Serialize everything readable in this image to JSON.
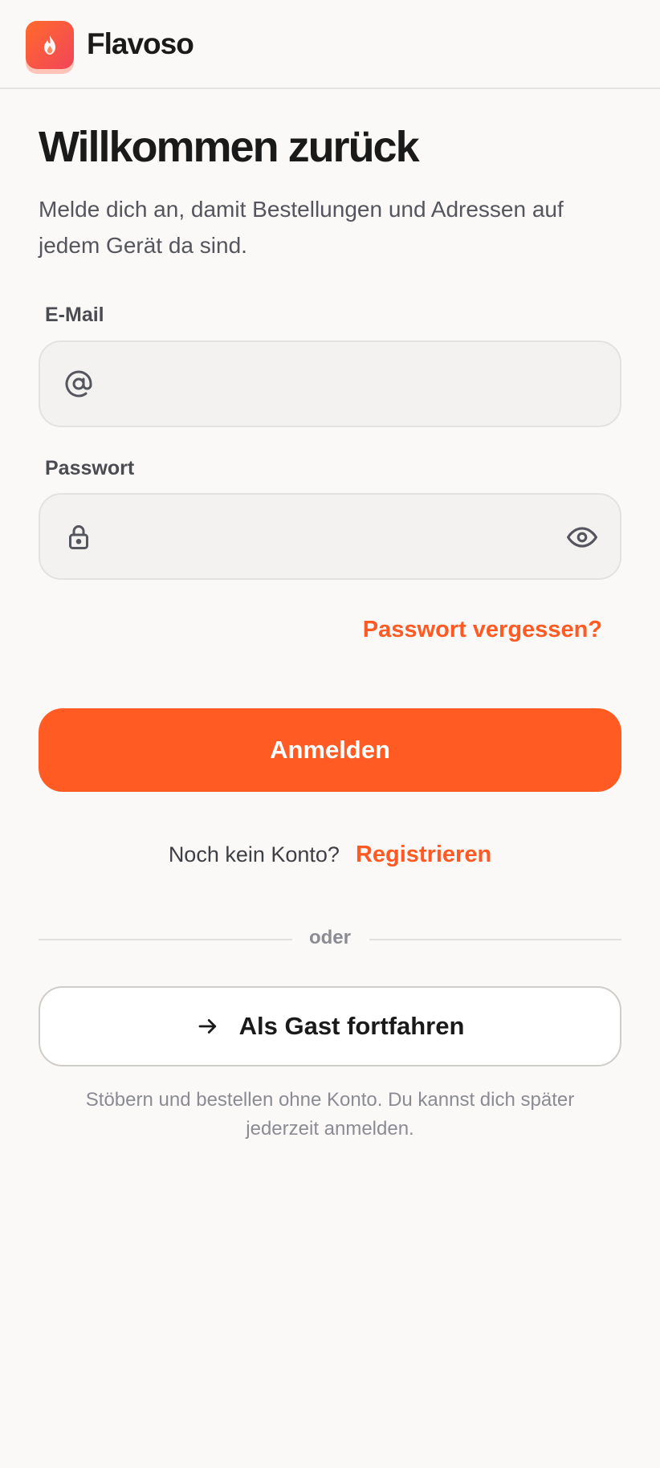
{
  "header": {
    "brand": "Flavoso",
    "logo_icon": "flame-icon"
  },
  "main": {
    "title": "Willkommen zurück",
    "subtitle": "Melde dich an, damit Bestellungen und Adressen auf jedem Gerät da sind."
  },
  "form": {
    "email_label": "E-Mail",
    "email_value": "",
    "email_placeholder": "",
    "email_icon": "at-sign-icon",
    "password_label": "Passwort",
    "password_value": "",
    "password_placeholder": "",
    "password_icon": "lock-icon",
    "password_toggle_icon": "eye-icon",
    "forgot_label": "Passwort vergessen?",
    "submit_label": "Anmelden"
  },
  "signup": {
    "prompt": "Noch kein Konto?",
    "link": "Registrieren"
  },
  "divider": {
    "text": "oder"
  },
  "guest": {
    "icon": "arrow-right-icon",
    "label": "Als Gast fortfahren",
    "hint": "Stöbern und bestellen ohne Konto. Du kannst dich später jederzeit anmelden."
  },
  "colors": {
    "accent": "#ff5b22",
    "background": "#faf9f7",
    "text_primary": "#1a1a1a",
    "text_secondary": "#55555d",
    "text_muted": "#8b8b93"
  }
}
